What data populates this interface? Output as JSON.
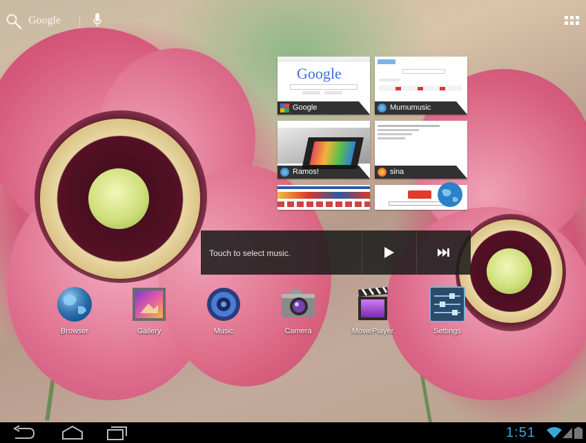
{
  "top_bar": {
    "search_label": "Google"
  },
  "recent_widget": {
    "items": [
      {
        "label": "Google",
        "icon": "google-icon"
      },
      {
        "label": "Mumumusic",
        "icon": "browser-icon"
      },
      {
        "label": "Ramos!",
        "icon": "browser-icon"
      },
      {
        "label": "sina",
        "icon": "weibo-icon"
      }
    ],
    "thumb_google_logo": "Google"
  },
  "music_widget": {
    "prompt": "Touch to select music."
  },
  "dock": {
    "apps": [
      {
        "label": "Browser",
        "icon": "globe-icon"
      },
      {
        "label": "Gallery",
        "icon": "picture-icon"
      },
      {
        "label": "Music",
        "icon": "speaker-icon"
      },
      {
        "label": "Camera",
        "icon": "camera-icon"
      },
      {
        "label": "MoviePlayer",
        "icon": "clapperboard-icon"
      },
      {
        "label": "Settings",
        "icon": "sliders-icon"
      }
    ]
  },
  "status_bar": {
    "time": "1:51"
  },
  "colors": {
    "accent": "#3aa7d8",
    "nav_bg": "#000000"
  }
}
